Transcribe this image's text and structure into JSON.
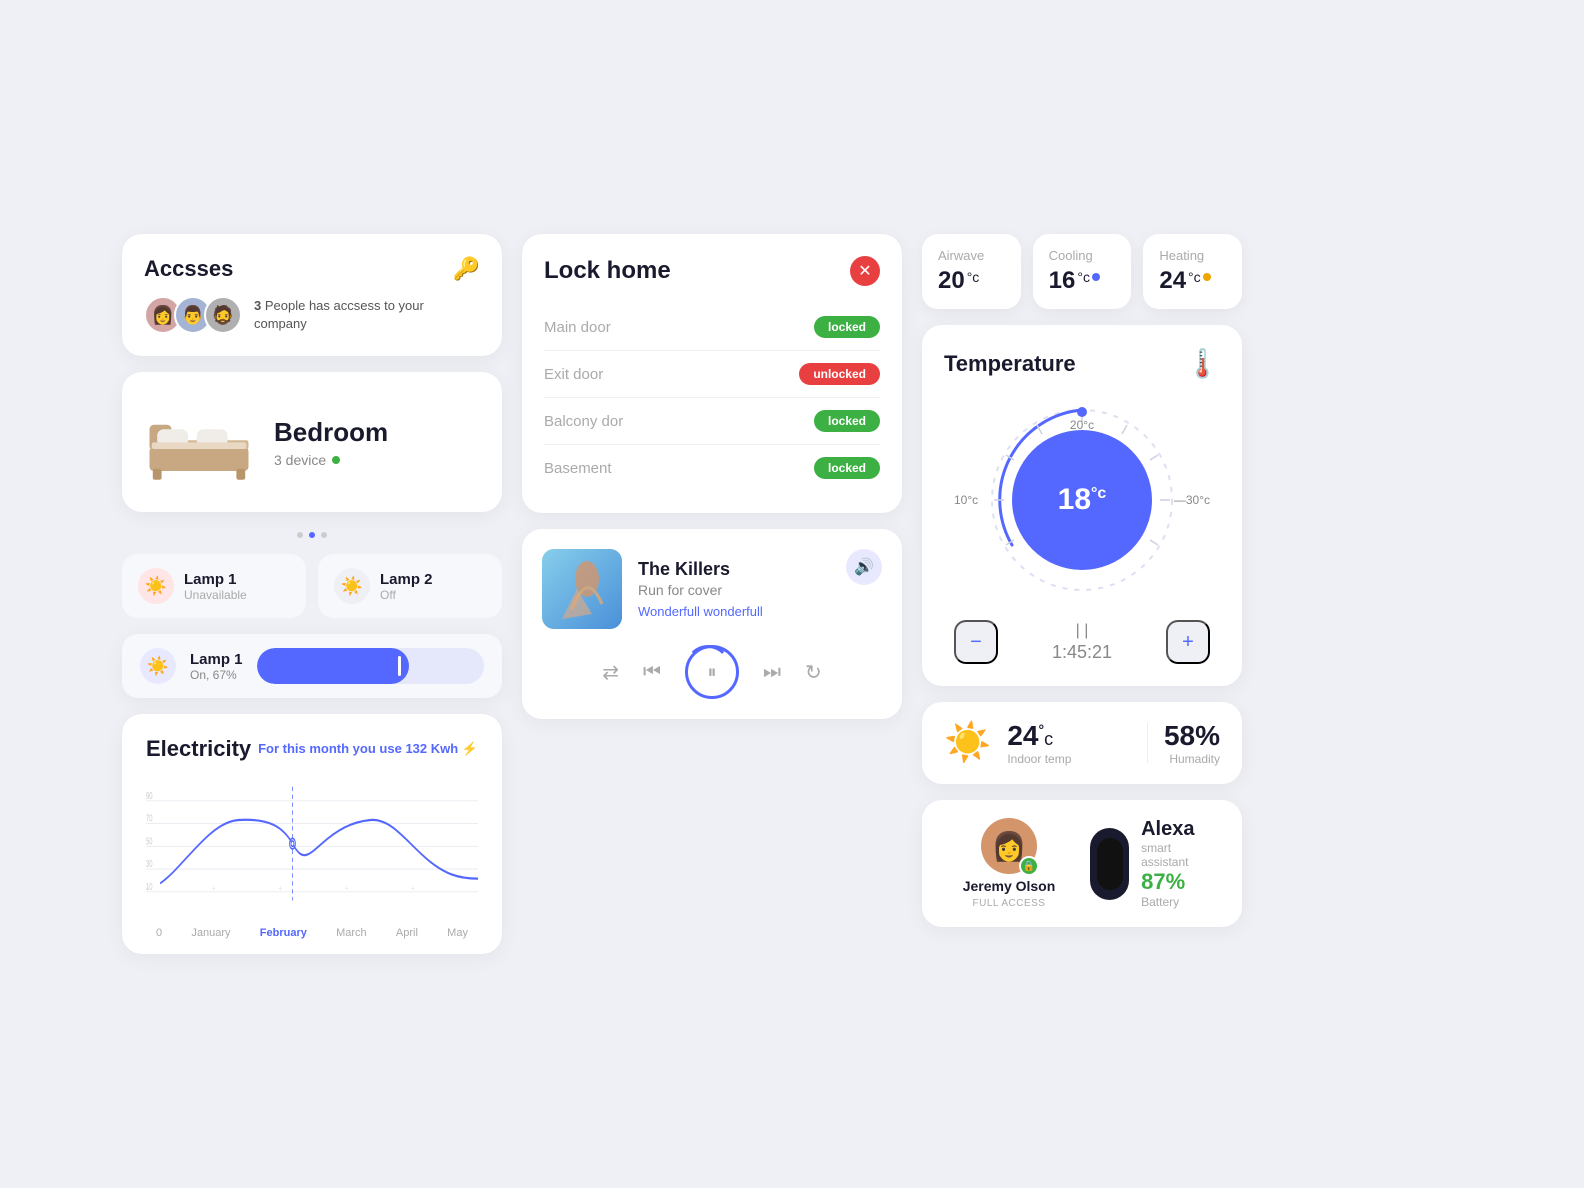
{
  "accesses": {
    "title": "Accsses",
    "count": "3",
    "description": "People has accsess to your company"
  },
  "bedroom": {
    "title": "Bedroom",
    "devices": "3 device"
  },
  "lamps": [
    {
      "name": "Lamp 1",
      "status": "Unavailable",
      "state": "unavail"
    },
    {
      "name": "Lamp 2",
      "status": "Off",
      "state": "off"
    }
  ],
  "lamp_slider": {
    "name": "Lamp 1",
    "status": "On, 67%",
    "percentage": 67
  },
  "electricity": {
    "title": "Electricity",
    "subtitle": "For this month you use",
    "value": "132 Kwh",
    "y_labels": [
      "90",
      "70",
      "50",
      "30",
      "10"
    ],
    "x_labels": [
      "0",
      "January",
      "February",
      "March",
      "April",
      "May"
    ],
    "active_month": "February"
  },
  "lock_home": {
    "title": "Lock home",
    "doors": [
      {
        "name": "Main door",
        "status": "locked",
        "type": "locked"
      },
      {
        "name": "Exit door",
        "status": "unlocked",
        "type": "unlocked"
      },
      {
        "name": "Balcony dor",
        "status": "locked",
        "type": "locked"
      },
      {
        "name": "Basement",
        "status": "locked",
        "type": "locked"
      }
    ]
  },
  "music": {
    "artist": "The Killers",
    "song": "Run for cover",
    "lyrics": "Wonderfull wonderfull",
    "controls": {
      "shuffle": "⇄",
      "prev": "⏮",
      "play": "⏸",
      "next": "⏭",
      "repeat": "↻"
    }
  },
  "sensors": [
    {
      "label": "Airwave",
      "value": "20",
      "unit": "°c",
      "dot": "none"
    },
    {
      "label": "Cooling",
      "value": "16",
      "unit": "°c",
      "dot": "blue"
    },
    {
      "label": "Heating",
      "value": "24",
      "unit": "°c",
      "dot": "orange"
    }
  ],
  "temperature": {
    "title": "Temperature",
    "current": "18",
    "unit": "°c",
    "min": "10°c",
    "max": "30°c",
    "target": "20°c",
    "time": "1:45:21",
    "minus_label": "−",
    "plus_label": "+"
  },
  "indoor": {
    "temp": "24",
    "temp_unit": "°c",
    "temp_label": "Indoor temp",
    "humidity": "58%",
    "humidity_label": "Humadity"
  },
  "alexa": {
    "user_name": "Jeremy Olson",
    "user_role": "FULL ACCESS",
    "device_name": "Alexa",
    "device_type": "smart assistant",
    "battery": "87%",
    "battery_label": "Battery"
  }
}
